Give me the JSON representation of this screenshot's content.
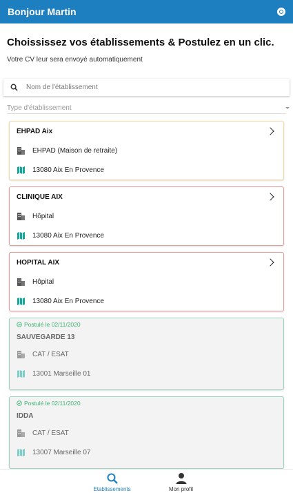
{
  "header": {
    "title": "Bonjour Martin",
    "action_icon": "settings-icon"
  },
  "page": {
    "title": "Choississez vos établissements & Postulez en un clic.",
    "subtitle": "Votre CV leur sera envoyé automatiquement"
  },
  "search": {
    "placeholder": "Nom de l'établissement"
  },
  "filter": {
    "label": "Type d'établissement"
  },
  "colors": {
    "primary": "#1e7fc0",
    "applied": "#3cb371",
    "map_icon": "#1aa39a"
  },
  "establishments": [
    {
      "name": "EHPAD Aix",
      "type": "EHPAD (Maison de retraite)",
      "address": "13080 Aix En Provence",
      "status": "pending"
    },
    {
      "name": "CLINIQUE AIX",
      "type": "Hôpital",
      "address": "13080 Aix En Provence",
      "status": "pending"
    },
    {
      "name": "HOPITAL AIX",
      "type": "Hôpital",
      "address": "13080 Aix En Provence",
      "status": "pending"
    },
    {
      "name": "SAUVEGARDE 13",
      "type": "CAT / ESAT",
      "address": "13001 Marseille 01",
      "status": "applied",
      "applied_label": "Postulé le 02/11/2020"
    },
    {
      "name": "IDDA",
      "type": "CAT / ESAT",
      "address": "13007 Marseille 07",
      "status": "applied",
      "applied_label": "Postulé le 02/11/2020"
    }
  ],
  "nav": [
    {
      "label": "Etablissements",
      "icon": "search-icon",
      "active": true
    },
    {
      "label": "Mon profil",
      "icon": "user-icon",
      "active": false
    }
  ]
}
